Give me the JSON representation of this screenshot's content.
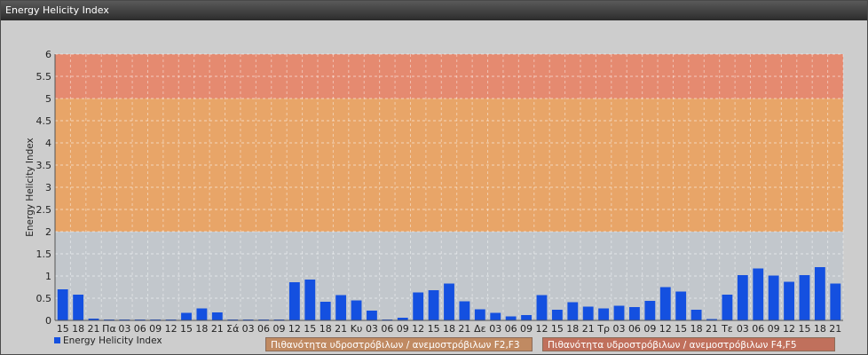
{
  "window": {
    "title": "Energy Helicity Index"
  },
  "chart_data": {
    "type": "bar",
    "ylabel": "Energy Helicity Index",
    "xlabel": "",
    "ylim": [
      0,
      6
    ],
    "yticks": [
      "0",
      "0.5",
      "1",
      "1.5",
      "2",
      "2.5",
      "3",
      "3.5",
      "4",
      "4.5",
      "5",
      "5.5",
      "6"
    ],
    "grid": true,
    "legend_position": "bottom-left",
    "categories": [
      "15",
      "18",
      "21",
      "Πα",
      "03",
      "06",
      "09",
      "12",
      "15",
      "18",
      "21",
      "Σά",
      "03",
      "06",
      "09",
      "12",
      "15",
      "18",
      "21",
      "Κυ",
      "03",
      "06",
      "09",
      "12",
      "15",
      "18",
      "21",
      "Δε",
      "03",
      "06",
      "09",
      "12",
      "15",
      "18",
      "21",
      "Τρ",
      "03",
      "06",
      "09",
      "12",
      "15",
      "18",
      "21",
      "Τε",
      "03",
      "06",
      "09",
      "12",
      "15",
      "18",
      "21"
    ],
    "series": [
      {
        "name": "Energy Helicity Index",
        "color": "#1450e0",
        "values": [
          0.7,
          0.58,
          0.04,
          0.02,
          0.02,
          0.02,
          0.02,
          0.02,
          0.17,
          0.27,
          0.18,
          0.02,
          0.02,
          0.02,
          0.02,
          0.86,
          0.92,
          0.42,
          0.57,
          0.45,
          0.22,
          0.02,
          0.06,
          0.63,
          0.68,
          0.83,
          0.43,
          0.25,
          0.17,
          0.09,
          0.12,
          0.57,
          0.24,
          0.41,
          0.31,
          0.27,
          0.33,
          0.3,
          0.44,
          0.75,
          0.65,
          0.24,
          0.03,
          0.58,
          1.02,
          1.17,
          1.01,
          0.87,
          1.02,
          1.2,
          0.83
        ]
      }
    ],
    "bands": [
      {
        "from": 2,
        "to": 5,
        "color": "#e8a568"
      },
      {
        "from": 5,
        "to": 6,
        "color": "#e58a70"
      }
    ],
    "band_legend": [
      {
        "label": "Πιθανότητα υδροστρόβιλων / ανεμοστρόβιλων F2,F3",
        "color": "#c08a62"
      },
      {
        "label": "Πιθανότητα υδροστρόβιλων / ανεμοστρόβιλων F4,F5",
        "color": "#c0705c"
      }
    ]
  }
}
